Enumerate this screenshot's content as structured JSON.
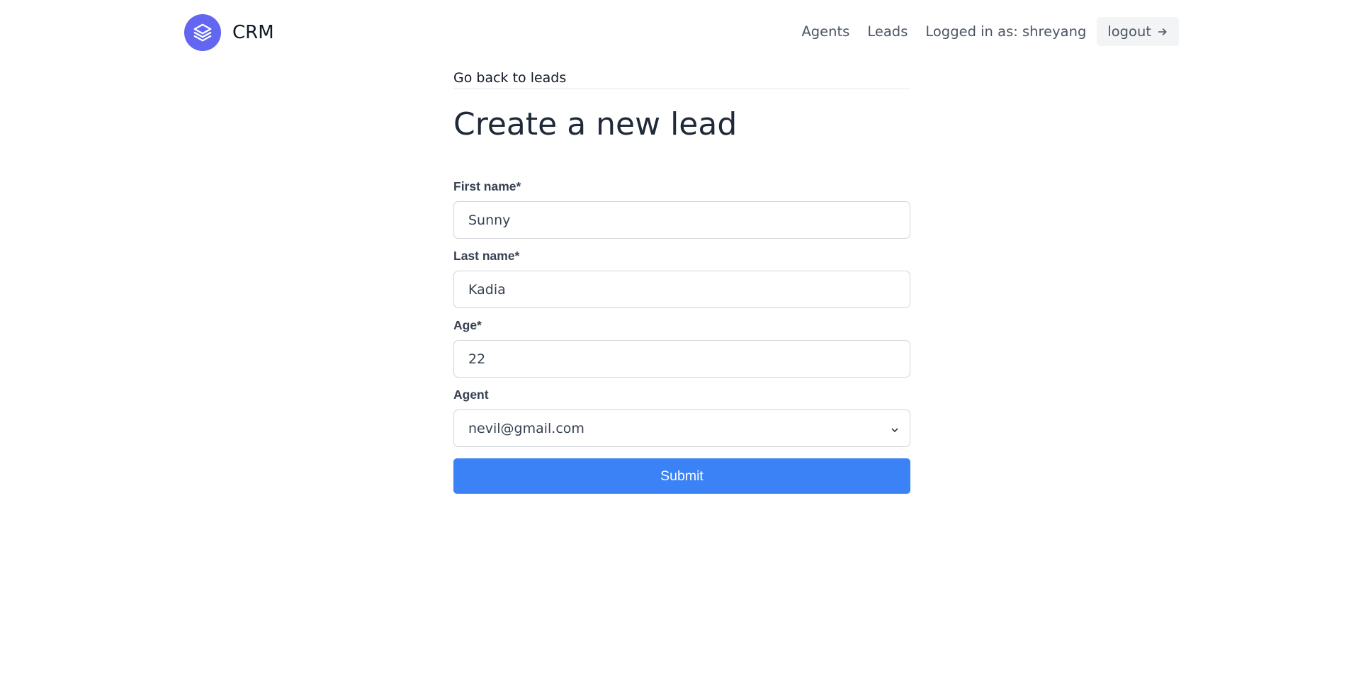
{
  "header": {
    "brand_name": "CRM",
    "brand_icon": "stack-layers-icon",
    "brand_color": "#6366f1",
    "nav": {
      "agents_label": "Agents",
      "leads_label": "Leads",
      "logged_in_text": "Logged in as: shreyang",
      "logout_label": "logout"
    }
  },
  "main": {
    "back_link": "Go back to leads",
    "title": "Create a new lead",
    "form": {
      "first_name": {
        "label": "First name*",
        "value": "Sunny"
      },
      "last_name": {
        "label": "Last name*",
        "value": "Kadia"
      },
      "age": {
        "label": "Age*",
        "value": "22"
      },
      "agent": {
        "label": "Agent",
        "selected": "nevil@gmail.com"
      },
      "submit_label": "Submit",
      "submit_color": "#3b82f6"
    }
  }
}
